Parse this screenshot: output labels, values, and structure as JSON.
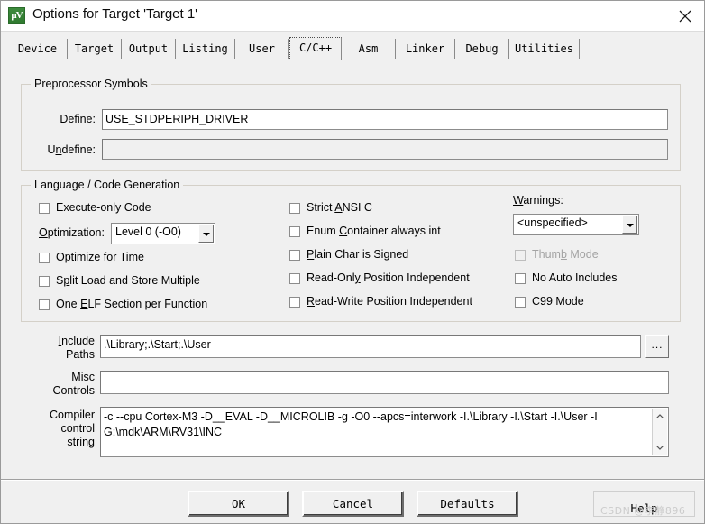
{
  "window": {
    "title": "Options for Target 'Target 1'",
    "icon": "keil-uvision-icon",
    "close_icon": "close-icon"
  },
  "tabs": [
    {
      "label": "Device",
      "selected": false
    },
    {
      "label": "Target",
      "selected": false
    },
    {
      "label": "Output",
      "selected": false
    },
    {
      "label": "Listing",
      "selected": false
    },
    {
      "label": "User",
      "selected": false
    },
    {
      "label": "C/C++",
      "selected": true
    },
    {
      "label": "Asm",
      "selected": false
    },
    {
      "label": "Linker",
      "selected": false
    },
    {
      "label": "Debug",
      "selected": false
    },
    {
      "label": "Utilities",
      "selected": false
    }
  ],
  "preprocessor": {
    "group_title": "Preprocessor Symbols",
    "define_label": "Define:",
    "define_value": "USE_STDPERIPH_DRIVER",
    "undefine_label": "Undefine:",
    "undefine_value": "",
    "undefine_enabled": false
  },
  "language": {
    "group_title": "Language / Code Generation",
    "left_checkboxes": [
      {
        "label": "Execute-only Code",
        "checked": false,
        "enabled": true
      },
      {
        "label": "Optimize for Time",
        "checked": false,
        "enabled": true
      },
      {
        "label": "Split Load and Store Multiple",
        "checked": false,
        "enabled": true
      },
      {
        "label": "One ELF Section per Function",
        "checked": false,
        "enabled": true
      }
    ],
    "optimization_label": "Optimization:",
    "optimization_value": "Level 0 (-O0)",
    "middle_checkboxes": [
      {
        "label": "Strict ANSI C",
        "checked": false,
        "enabled": true
      },
      {
        "label": "Enum Container always int",
        "checked": false,
        "enabled": true
      },
      {
        "label": "Plain Char is Signed",
        "checked": false,
        "enabled": true
      },
      {
        "label": "Read-Only Position Independent",
        "checked": false,
        "enabled": true
      },
      {
        "label": "Read-Write Position Independent",
        "checked": false,
        "enabled": true
      }
    ],
    "warnings_label": "Warnings:",
    "warnings_value": "<unspecified>",
    "right_checkboxes": [
      {
        "label": "Thumb Mode",
        "checked": false,
        "enabled": false
      },
      {
        "label": "No Auto Includes",
        "checked": false,
        "enabled": true
      },
      {
        "label": "C99 Mode",
        "checked": false,
        "enabled": true
      }
    ]
  },
  "paths": {
    "include_label_line1": "Include",
    "include_label_line2": "Paths",
    "include_value": ".\\Library;.\\Start;.\\User",
    "browse_label": "...",
    "misc_label_line1": "Misc",
    "misc_label_line2": "Controls",
    "misc_value": "",
    "compiler_label_line1": "Compiler",
    "compiler_label_line2": "control",
    "compiler_label_line3": "string",
    "compiler_value": "-c --cpu Cortex-M3 -D__EVAL -D__MICROLIB -g -O0 --apcs=interwork -I.\\Library -I.\\Start -I.\\User -I G:\\mdk\\ARM\\RV31\\INC"
  },
  "buttons": {
    "ok": "OK",
    "cancel": "Cancel",
    "defaults": "Defaults",
    "help": "Help"
  },
  "watermark": "CSDN @李静896"
}
